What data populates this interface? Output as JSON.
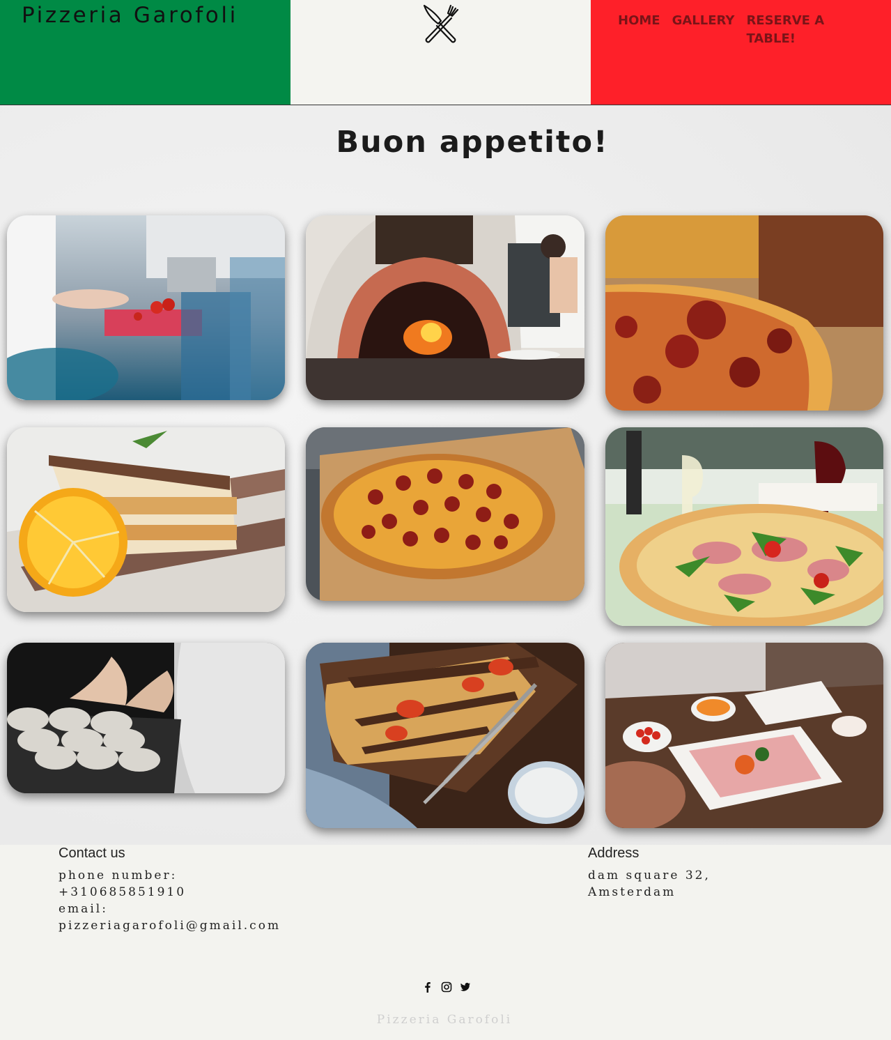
{
  "header": {
    "brand": "Pizzeria Garofoli",
    "logo_icon": "fork-knife-icon",
    "nav": {
      "home": "HOME",
      "gallery": "GALLERY",
      "reserve_line1": "RESERVE A",
      "reserve_line2": "TABLE!"
    },
    "colors": {
      "green": "#008a45",
      "white": "#f4f4f0",
      "red": "#fe2029",
      "nav_text": "#7a1418"
    }
  },
  "gallery": {
    "title": "Buon appetito!",
    "photos": [
      "chef-chopping-tomatoes-photo",
      "brick-pizza-oven-photo",
      "pepperoni-pizza-closeup-photo",
      "tiramisu-with-orange-photo",
      "pepperoni-pizza-on-board-photo",
      "prosciutto-arugula-pizza-photo",
      "dough-balls-on-tray-photo",
      "focaccia-with-tomatoes-photo",
      "antipasti-platter-photo"
    ]
  },
  "footer": {
    "contact_heading": "Contact us",
    "phone_label": "phone number:",
    "phone": "+310685851910",
    "email_label": "email:",
    "email": "pizzeriagarofoli@gmail.com",
    "address_heading": "Address",
    "address_line1": "dam square 32,",
    "address_line2": "Amsterdam",
    "social_icons": [
      "facebook-icon",
      "instagram-icon",
      "twitter-icon"
    ],
    "copyright": "Pizzeria Garofoli"
  }
}
